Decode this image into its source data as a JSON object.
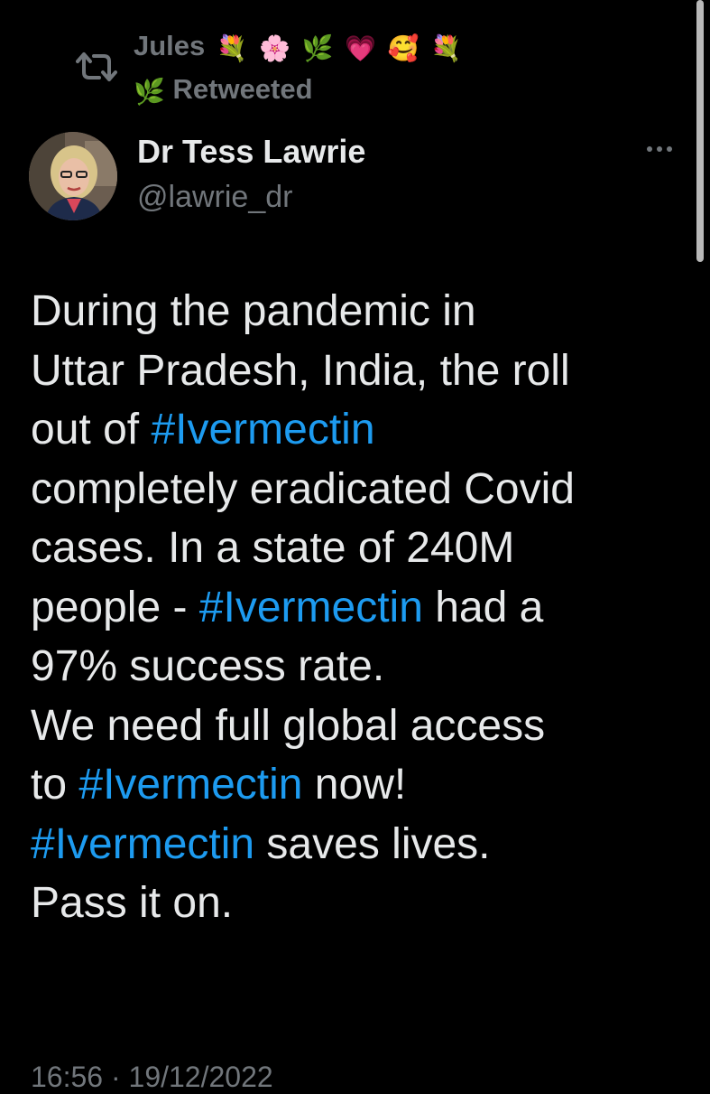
{
  "retweet_context": {
    "name": "Jules",
    "emojis_line1": [
      "💐",
      "🌸",
      "🌿",
      "💗",
      "🥰",
      "💐"
    ],
    "emoji_line2": "🌿",
    "label": "Retweeted"
  },
  "tweet": {
    "author_name": "Dr Tess Lawrie",
    "author_handle": "@lawrie_dr",
    "text_segments": [
      {
        "t": "During the pandemic in\nUttar Pradesh, India, the roll\nout of ",
        "tag": false
      },
      {
        "t": "#Ivermectin",
        "tag": true
      },
      {
        "t": "\ncompletely eradicated Covid\ncases. In a state of 240M\npeople - ",
        "tag": false
      },
      {
        "t": "#Ivermectin",
        "tag": true
      },
      {
        "t": " had a\n97% success rate.\nWe need full global access\nto ",
        "tag": false
      },
      {
        "t": "#Ivermectin",
        "tag": true
      },
      {
        "t": " now!\n",
        "tag": false
      },
      {
        "t": "#Ivermectin",
        "tag": true
      },
      {
        "t": " saves lives.\nPass it on.",
        "tag": false
      }
    ],
    "timestamp": "16:56 · 19/12/2022"
  },
  "colors": {
    "background": "#000000",
    "text": "#e7e9ea",
    "muted": "#71767b",
    "hashtag": "#1d9bf0"
  },
  "icons": {
    "retweet": "retweet-icon",
    "more": "more-horizontal-icon"
  }
}
